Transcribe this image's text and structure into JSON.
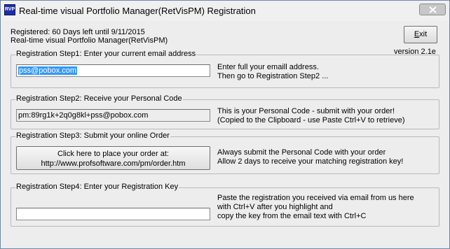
{
  "window": {
    "icon_text": "RVP",
    "title": "Real-time visual Portfolio Manager(RetVisPM) Registration"
  },
  "header": {
    "registered_text": "Registered: 60 Days left until 9/11/2015",
    "product_name": "Real-time visual Portfolio Manager(RetVisPM)",
    "exit_label_underlined": "E",
    "exit_label_rest": "xit",
    "version": "version 2.1e"
  },
  "step1": {
    "legend": "Registration Step1: Enter your current email address",
    "email_value": "pss@pobox.com",
    "note_line1": "Enter full your emaill address.",
    "note_line2": "Then go to Registration Step2 ..."
  },
  "step2": {
    "legend": "Registration Step2: Receive your Personal Code",
    "code_value": "pm:89rg1k+2q0g8kl+pss@pobox.com",
    "note_line1": "This is your Personal Code - submit with your order!",
    "note_line2": "(Copied to the Clipboard - use Paste Ctrl+V to retrieve)"
  },
  "step3": {
    "legend": "Registration Step3: Submit your online Order",
    "button_line1": "Click here to place your order at:",
    "button_line2": "http://www.profsoftware.com/pm/order.htm",
    "note_line1": "Always submit the Personal Code with your order",
    "note_line2": "Allow 2 days to receive your matching registration key!"
  },
  "step4": {
    "legend": "Registration Step4: Enter your Registration Key",
    "key_value": "",
    "note_line1": "Paste the registration you received via email from us here",
    "note_line2": "with Ctrl+V after you highlight and",
    "note_line3": "copy the key from the email text with Ctrl+C"
  }
}
